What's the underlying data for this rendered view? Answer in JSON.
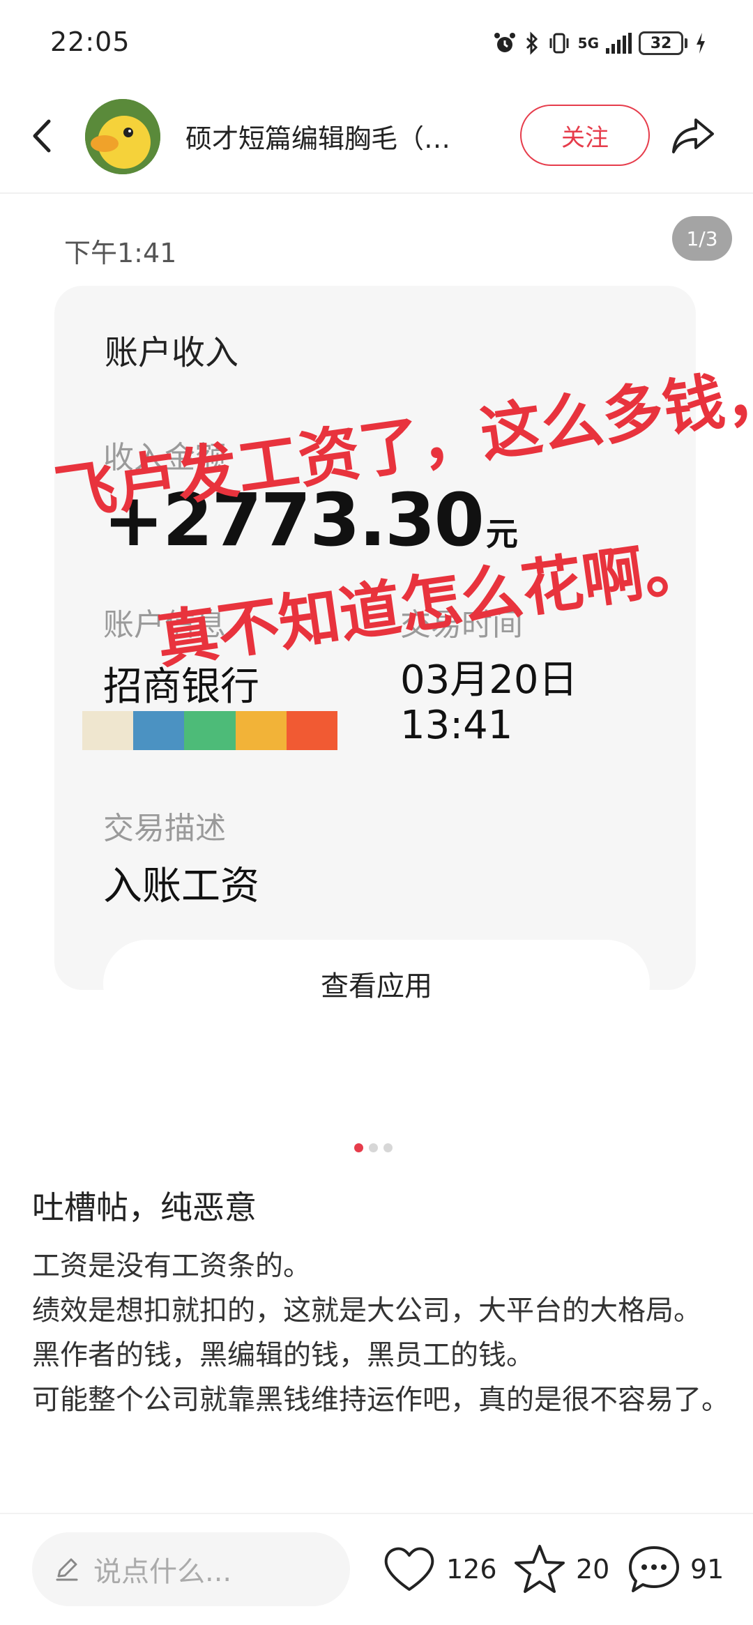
{
  "status_bar": {
    "time": "22:05",
    "network": "5G",
    "battery": "32"
  },
  "header": {
    "title": "硕才短篇编辑胸毛（…",
    "follow_label": "关注"
  },
  "image": {
    "time": "下午1:41",
    "page_indicator": "1/3",
    "card_partial_title": "账户收入",
    "income_label": "收入金额",
    "amount": "+2773.30",
    "amount_unit": "元",
    "account_label": "账户信息",
    "account_value": "招商银行",
    "time_label": "交易时间",
    "time_date": "03月20日",
    "time_clock": "13:41",
    "desc_label": "交易描述",
    "desc_value": "入账工资",
    "view_app_label": "查看应用",
    "overlay_line1": "飞卢发工资了，这么多钱，",
    "overlay_line2": "真不知道怎么花啊。",
    "strip_colors": [
      "#efe6cf",
      "#4b92c2",
      "#4dbb78",
      "#f2b338",
      "#f15a33"
    ]
  },
  "carousel": {
    "count": 3,
    "active": 0
  },
  "post": {
    "title": "吐槽帖，纯恶意",
    "lines": [
      "工资是没有工资条的。",
      "绩效是想扣就扣的，这就是大公司，大平台的大格局。",
      "黑作者的钱，黑编辑的钱，黑员工的钱。",
      "可能整个公司就靠黑钱维持运作吧，真的是很不容易了。"
    ]
  },
  "bottom_bar": {
    "comment_placeholder": "说点什么...",
    "like_count": "126",
    "favorite_count": "20",
    "comment_count": "91"
  },
  "colors": {
    "accent": "#e63c4b",
    "overlay_text": "#e8333d",
    "card_bg": "#f6f6f6"
  }
}
